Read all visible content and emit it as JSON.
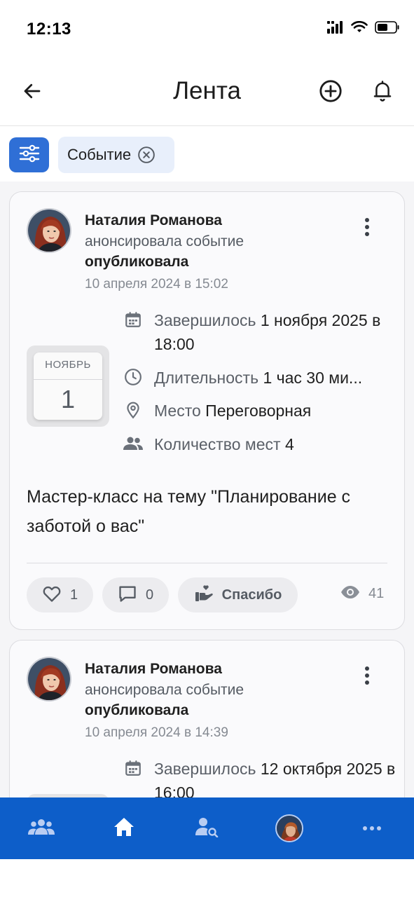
{
  "status_bar": {
    "time": "12:13"
  },
  "header": {
    "title": "Лента"
  },
  "filters": {
    "chip_label": "Событие"
  },
  "posts": [
    {
      "author": "Наталия Романова",
      "action": "анонсировала событие",
      "status": "опубликовала",
      "date": "10 апреля 2024 в 15:02",
      "calendar": {
        "month": "НОЯБРЬ",
        "day": "1"
      },
      "ended_key": "Завершилось",
      "ended_value": "1 ноября 2025 в 18:00",
      "duration_key": "Длительность",
      "duration_value": "1 час 30 ми...",
      "place_key": "Место",
      "place_value": "Переговорная",
      "seats_key": "Количество мест",
      "seats_value": "4",
      "description": "Мастер-класс на тему \"Планирование с заботой о вас\"",
      "likes": "1",
      "comments": "0",
      "thanks_label": "Спасибо",
      "views": "41"
    },
    {
      "author": "Наталия Романова",
      "action": "анонсировала событие",
      "status": "опубликовала",
      "date": "10 апреля 2024 в 14:39",
      "ended_key": "Завершилось",
      "ended_value": "12 октября 2025 в 16:00"
    }
  ],
  "colors": {
    "accent": "#2f6fd6",
    "nav_background": "#0d5ec9",
    "chip_background": "#e8effb"
  },
  "icons": {
    "back": "arrow-left-icon",
    "add": "plus-circle-icon",
    "notifications": "bell-icon",
    "filter": "sliders-icon",
    "chip_close": "close-circle-icon",
    "more": "more-vertical-icon",
    "nav": [
      "people-icon",
      "home-icon",
      "user-search-icon",
      "profile-avatar",
      "more-horizontal-icon"
    ]
  }
}
